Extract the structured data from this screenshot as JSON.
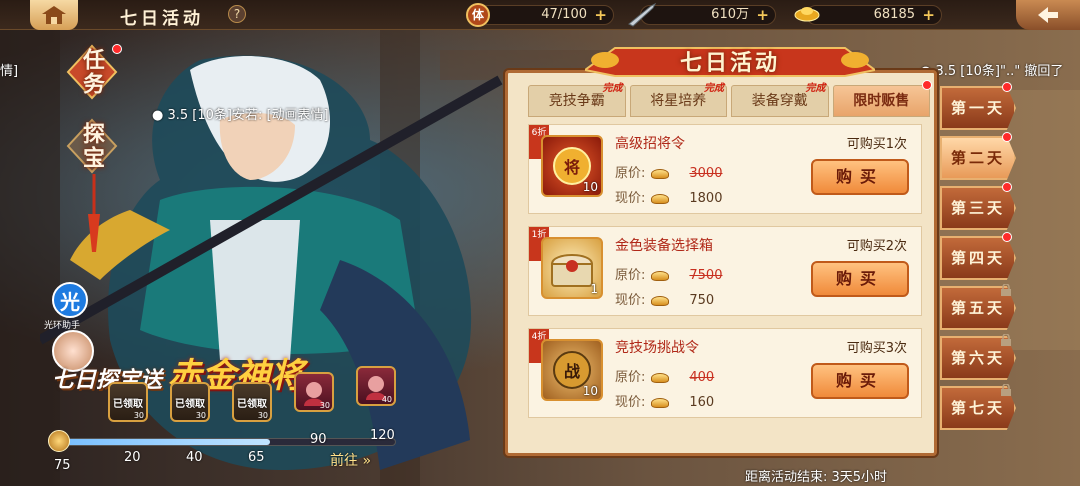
{
  "topbar": {
    "title": "七日活动",
    "help": "?",
    "stamina_label": "体",
    "stamina": "47/100",
    "silver": "610万",
    "gold": "68185",
    "plus": "+"
  },
  "left_tabs": [
    {
      "label": "任务"
    },
    {
      "label": "探宝"
    }
  ],
  "left_edge_text": "情]",
  "chat_left": "3.5 [10条]安若: [动画表情]",
  "chat_right": "3.5 [10条]\"..\" 撤回了",
  "helper": {
    "icon": "光",
    "label": "光环助手"
  },
  "promo": {
    "line1": "七日探宝送",
    "line2": "赤金神将"
  },
  "rewards": [
    {
      "label": "已领取",
      "count": "30",
      "claimed": true
    },
    {
      "label": "已领取",
      "count": "30",
      "claimed": true
    },
    {
      "label": "已领取",
      "count": "30",
      "claimed": true
    },
    {
      "label": "",
      "count": "30",
      "claimed": false
    },
    {
      "label": "",
      "count": "40",
      "claimed": false
    }
  ],
  "progress": {
    "current": "75",
    "fraction": 0.62,
    "marks": [
      "20",
      "40",
      "65",
      "90",
      "120"
    ],
    "go": "前往"
  },
  "panel": {
    "title": "七日活动",
    "tabs": [
      {
        "label": "竞技争霸",
        "done": "完成",
        "active": false
      },
      {
        "label": "将星培养",
        "done": "完成",
        "active": false
      },
      {
        "label": "装备穿戴",
        "done": "完成",
        "active": false
      },
      {
        "label": "限时贩售",
        "done": "",
        "active": true
      }
    ],
    "items": [
      {
        "discount": "6折",
        "name": "高级招将令",
        "limit": "可购买1次",
        "orig_label": "原价:",
        "orig": "3000",
        "cur_label": "现价:",
        "cur": "1800",
        "qty": "10",
        "buy": "购买",
        "glyph": "将"
      },
      {
        "discount": "1折",
        "name": "金色装备选择箱",
        "limit": "可购买2次",
        "orig_label": "原价:",
        "orig": "7500",
        "cur_label": "现价:",
        "cur": "750",
        "qty": "1",
        "buy": "购买",
        "glyph": ""
      },
      {
        "discount": "4折",
        "name": "竞技场挑战令",
        "limit": "可购买3次",
        "orig_label": "原价:",
        "orig": "400",
        "cur_label": "现价:",
        "cur": "160",
        "qty": "10",
        "buy": "购买",
        "glyph": "战"
      }
    ],
    "countdown": "距离活动结束: 3天5小时"
  },
  "days": [
    {
      "label": "第一天",
      "dot": true,
      "locked": false,
      "active": false
    },
    {
      "label": "第二天",
      "dot": true,
      "locked": false,
      "active": true
    },
    {
      "label": "第三天",
      "dot": true,
      "locked": false,
      "active": false
    },
    {
      "label": "第四天",
      "dot": true,
      "locked": false,
      "active": false
    },
    {
      "label": "第五天",
      "dot": false,
      "locked": true,
      "active": false
    },
    {
      "label": "第六天",
      "dot": false,
      "locked": true,
      "active": false
    },
    {
      "label": "第七天",
      "dot": false,
      "locked": true,
      "active": false
    }
  ],
  "colors": {
    "accent": "#e88a3a",
    "panel": "#f3e4c6",
    "price_red": "#c83020"
  }
}
